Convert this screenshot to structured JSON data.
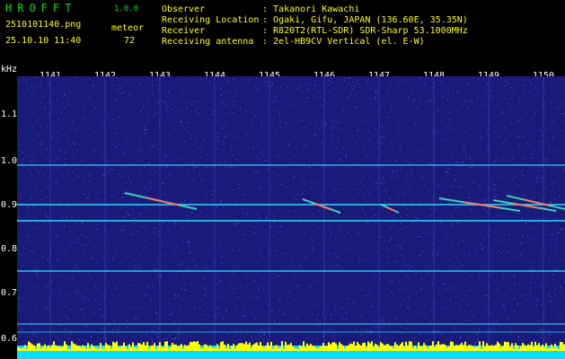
{
  "header": {
    "app_title": "HROFFT",
    "app_version": "1.0.0",
    "filename": "2510101140.png",
    "datetime": "25.10.10 11:40",
    "meteor_label": "meteor",
    "meteor_count": "72",
    "info_labels": [
      "Observer",
      "Receiving Location",
      "Receiver",
      "Receiving antenna"
    ],
    "info_values": [
      ": Takanori Kawachi",
      ": Ogaki, Gifu, JAPAN (136.60E, 35.35N)",
      ": R820T2(RTL-SDR) SDR-Sharp 53.1000MHz",
      ": 2el-HB9CV Vertical (el. E-W)"
    ]
  },
  "plot": {
    "unit_label": "kHz",
    "x_ticks": [
      "1141",
      "1142",
      "1143",
      "1144",
      "1145",
      "1146",
      "1147",
      "1148",
      "1149",
      "1150"
    ],
    "y_ticks": [
      "1.1",
      "1.0",
      "0.9",
      "0.8",
      "0.7",
      "0.6"
    ],
    "colors": {
      "background": "#1a1a7a",
      "noise": "#5a78ff",
      "carrier_line": "#30d8ff",
      "meteor_head": "#ff7060",
      "meteor_tail": "#40f0c0",
      "bottom_bar": "#00e0ff",
      "bottom_peaks": "#ffff00"
    }
  }
}
